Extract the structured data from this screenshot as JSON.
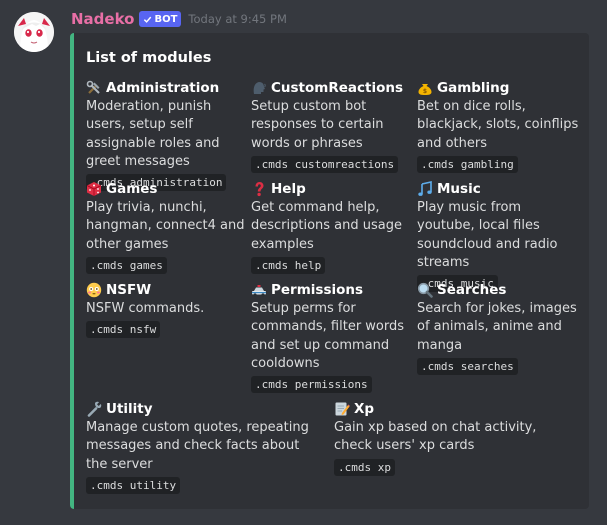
{
  "message": {
    "username": "Nadeko",
    "badge": "BOT",
    "timestamp": "Today at 9:45 PM"
  },
  "embed": {
    "title": "List of modules",
    "accent_color": "#43b581",
    "fields": [
      {
        "name": "Administration",
        "icon": "hammer-and-wrench-icon",
        "desc": "Moderation, punish users, setup self assignable roles and greet messages",
        "cmd": ".cmds administration"
      },
      {
        "name": "CustomReactions",
        "icon": "speaking-head-icon",
        "desc": "Setup custom bot responses to certain words or phrases",
        "cmd": ".cmds customreactions"
      },
      {
        "name": "Gambling",
        "icon": "money-bag-icon",
        "desc": "Bet on dice rolls, blackjack, slots, coinflips and others",
        "cmd": ".cmds gambling"
      },
      {
        "name": "Games",
        "icon": "game-die-icon",
        "desc": "Play trivia, nunchi, hangman, connect4 and other games",
        "cmd": ".cmds games"
      },
      {
        "name": "Help",
        "icon": "question-mark-icon",
        "desc": "Get command help, descriptions and usage examples",
        "cmd": ".cmds help"
      },
      {
        "name": "Music",
        "icon": "music-notes-icon",
        "desc": "Play music from youtube, local files soundcloud and radio streams",
        "cmd": ".cmds music"
      },
      {
        "name": "NSFW",
        "icon": "flushed-face-icon",
        "desc": "NSFW commands.",
        "cmd": ".cmds nsfw"
      },
      {
        "name": "Permissions",
        "icon": "police-car-icon",
        "desc": "Setup perms for commands, filter words and set up command cooldowns",
        "cmd": ".cmds permissions"
      },
      {
        "name": "Searches",
        "icon": "magnifying-glass-icon",
        "desc": "Search for jokes, images of animals, anime and manga",
        "cmd": ".cmds searches"
      },
      {
        "name": "Utility",
        "icon": "wrench-icon",
        "desc": "Manage custom quotes, repeating messages and check facts about the server",
        "cmd": ".cmds utility"
      },
      {
        "name": "Xp",
        "icon": "memo-icon",
        "desc": "Gain xp based on chat activity, check users' xp cards",
        "cmd": ".cmds xp"
      }
    ]
  }
}
